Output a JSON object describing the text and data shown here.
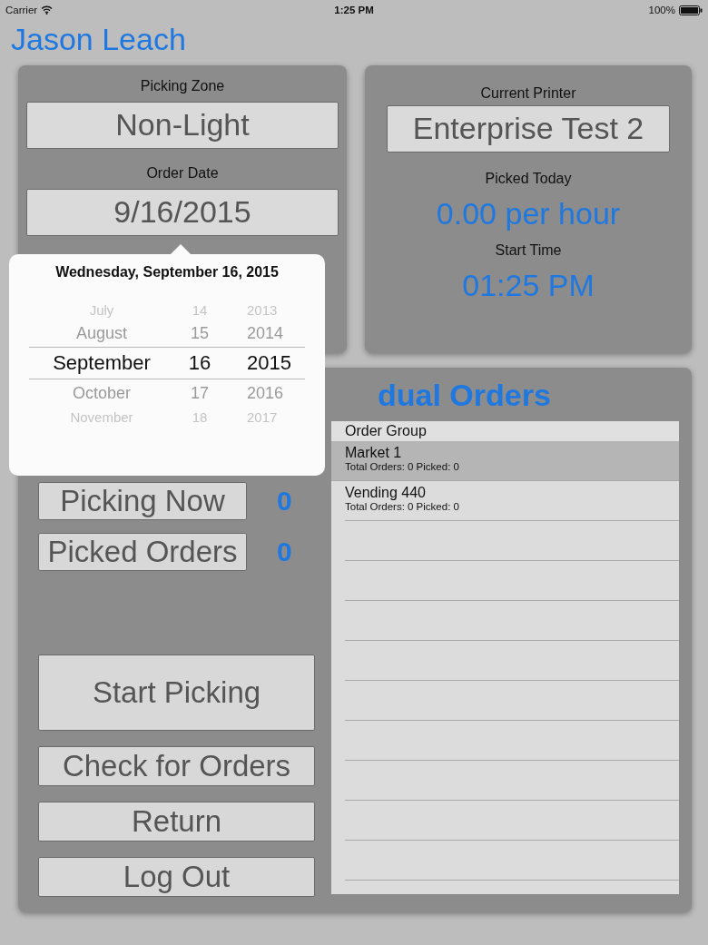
{
  "status_bar": {
    "carrier": "Carrier",
    "time": "1:25 PM",
    "battery": "100%"
  },
  "user_name": "Jason Leach",
  "zone_panel": {
    "picking_zone_label": "Picking Zone",
    "picking_zone": "Non-Light",
    "order_date_label": "Order Date",
    "order_date": "9/16/2015"
  },
  "printer_panel": {
    "current_printer_label": "Current Printer",
    "current_printer": "Enterprise Test 2",
    "picked_today_label": "Picked Today",
    "picked_today": "0.00 per hour",
    "start_time_label": "Start Time",
    "start_time": "01:25 PM"
  },
  "date_picker": {
    "title": "Wednesday, September 16, 2015",
    "rows": [
      {
        "month": "July",
        "day": "14",
        "year": "2013",
        "selected": false
      },
      {
        "month": "August",
        "day": "15",
        "year": "2014",
        "selected": false
      },
      {
        "month": "September",
        "day": "16",
        "year": "2015",
        "selected": true
      },
      {
        "month": "October",
        "day": "17",
        "year": "2016",
        "selected": false
      },
      {
        "month": "November",
        "day": "18",
        "year": "2017",
        "selected": false
      }
    ]
  },
  "counters": [
    {
      "label": "Picking Now",
      "value": "0"
    },
    {
      "label": "Picked Orders",
      "value": "0"
    }
  ],
  "actions": [
    {
      "label": "Start Picking",
      "kind": "large"
    },
    {
      "label": "Check for Orders",
      "kind": "normal"
    },
    {
      "label": "Return",
      "kind": "normal"
    },
    {
      "label": "Log Out",
      "kind": "normal"
    }
  ],
  "orders_heading": "dual Orders",
  "order_list": {
    "header": "Order Group",
    "rows": [
      {
        "name": "Market 1",
        "detail": "Total Orders: 0 Picked: 0",
        "selected": true
      },
      {
        "name": "Vending 440",
        "detail": "Total Orders: 0 Picked: 0",
        "selected": false
      }
    ]
  }
}
